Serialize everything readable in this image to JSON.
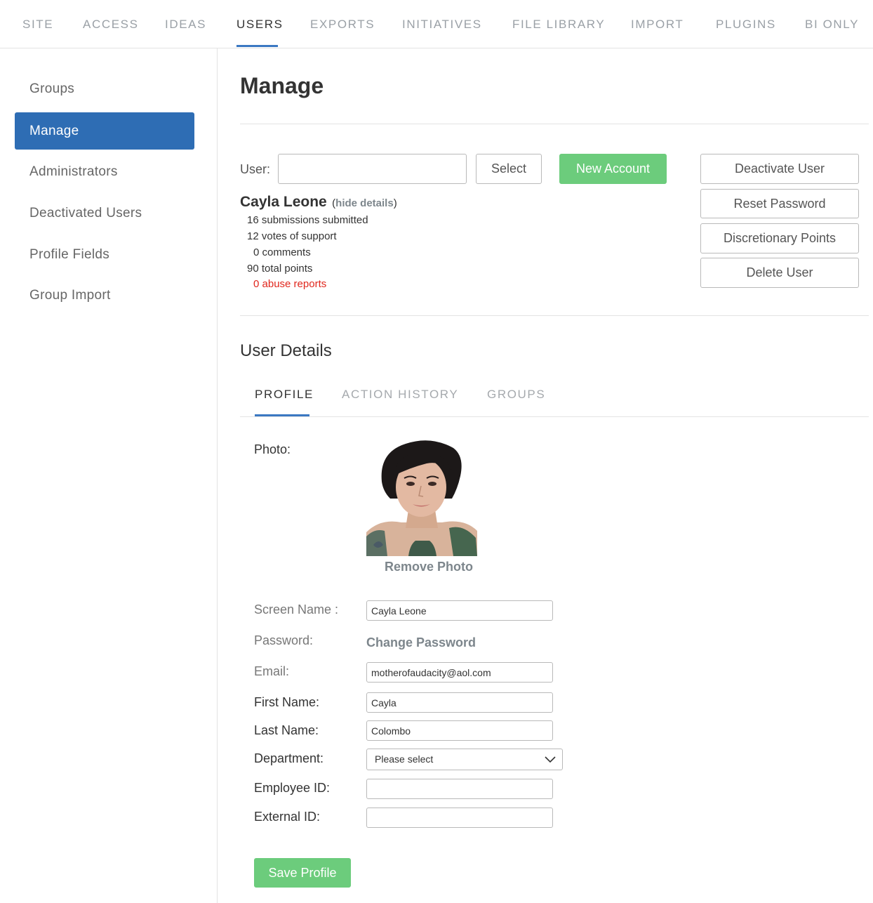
{
  "topnav": {
    "tabs": [
      "SITE",
      "ACCESS",
      "IDEAS",
      "USERS",
      "EXPORTS",
      "INITIATIVES",
      "FILE LIBRARY",
      "IMPORT",
      "PLUGINS",
      "BI ONLY"
    ],
    "active": "USERS"
  },
  "sidebar": {
    "items": [
      "Groups",
      "Manage",
      "Administrators",
      "Deactivated Users",
      "Profile Fields",
      "Group Import"
    ],
    "active": "Manage"
  },
  "main": {
    "title": "Manage",
    "user_label": "User:",
    "user_value": "",
    "select_label": "Select",
    "new_account_label": "New Account",
    "actions": [
      "Deactivate User",
      "Reset Password",
      "Discretionary Points",
      "Delete User"
    ],
    "selected_user": {
      "name": "Cayla Leone",
      "paren_open": "(",
      "hide_details": "hide details",
      "paren_close": ")",
      "stats": {
        "submissions": "16 submissions submitted",
        "votes": "12 votes of support",
        "comments": "0 comments",
        "points": "90 total points",
        "abuse": "0 abuse reports"
      }
    }
  },
  "details": {
    "title": "User Details",
    "tabs": [
      "PROFILE",
      "ACTION HISTORY",
      "GROUPS"
    ],
    "active_tab": "PROFILE",
    "photo_label": "Photo:",
    "remove_photo": "Remove Photo",
    "fields": {
      "screen_name": {
        "label": "Screen Name :",
        "value": "Cayla Leone"
      },
      "password": {
        "label": "Password:",
        "link": "Change Password"
      },
      "email": {
        "label": "Email:",
        "value": "motherofaudacity@aol.com"
      },
      "first_name": {
        "label": "First Name:",
        "value": "Cayla"
      },
      "last_name": {
        "label": "Last Name:",
        "value": "Colombo"
      },
      "department": {
        "label": "Department:",
        "value": "Please select"
      },
      "employee_id": {
        "label": "Employee ID:",
        "value": ""
      },
      "external_id": {
        "label": "External ID:",
        "value": ""
      }
    },
    "save_label": "Save Profile"
  },
  "colors": {
    "primary": "#2e6db4",
    "success": "#6ccc7c",
    "danger": "#e0261c",
    "tab_underline": "#3b78c2"
  }
}
